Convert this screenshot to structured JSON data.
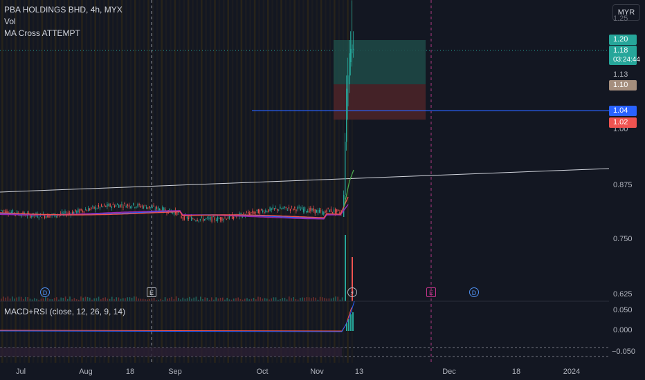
{
  "legend": {
    "title": "PBA HOLDINGS BHD, 4h, MYX",
    "vol": "Vol",
    "indicator": "MA Cross ATTEMPT",
    "macd": "MACD+RSI (close, 12, 26, 9, 14)"
  },
  "currency": "MYR",
  "price_axis": {
    "ticks": [
      "1.13",
      "1.00",
      "0.875",
      "0.750",
      "0.625"
    ],
    "top_partial": "1.25",
    "labels": {
      "target": "1.20",
      "last": "1.18",
      "countdown": "03:24:44",
      "entry": "1.10",
      "hline": "1.04",
      "stop": "1.02"
    }
  },
  "macd_axis": {
    "ticks": [
      "0.050",
      "0.000",
      "−0.050"
    ]
  },
  "time_axis": {
    "ticks": [
      "Jul",
      "Aug",
      "18",
      "Sep",
      "Oct",
      "Nov",
      "13",
      "Dec",
      "18",
      "2024"
    ]
  },
  "markers": {
    "dividend": "D",
    "earnings": "E",
    "split": "⚡"
  },
  "colors": {
    "background": "#131722",
    "up": "#26a69a",
    "down": "#ef5350",
    "hline": "#2962ff",
    "target_zone": "#1f4a47",
    "stop_zone": "#4a2328",
    "trendline": "#d1d4dc"
  },
  "chart_data": {
    "type": "candlestick",
    "symbol": "PBA HOLDINGS BHD",
    "timeframe": "4h",
    "exchange": "MYX",
    "ylim": [
      0.6,
      1.29
    ],
    "price_segments": [
      {
        "period": "Jul to early Nov",
        "range": [
          0.79,
          0.83
        ]
      },
      {
        "period": "Nov 10 breakout",
        "range": [
          0.8,
          1.27
        ]
      }
    ],
    "last_price": 1.18,
    "position": {
      "entry": 1.1,
      "target": 1.2,
      "stop": 1.02
    },
    "horizontal_line": 1.04,
    "macd_ylim": [
      -0.06,
      0.07
    ]
  }
}
